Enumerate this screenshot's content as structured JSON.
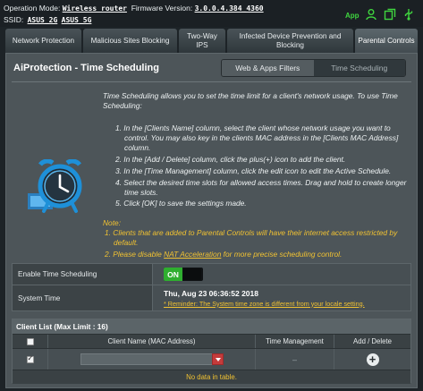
{
  "header": {
    "operation_mode_label": "Operation Mode:",
    "operation_mode_value": "Wireless router",
    "firmware_label": "Firmware Version:",
    "firmware_value": "3.0.0.4.384_4360",
    "ssid_label": "SSID:",
    "ssid_values": [
      "ASUS_2G",
      "ASUS_5G"
    ],
    "app_label": "App",
    "icons": [
      "users-icon",
      "copy-icon",
      "usb-icon"
    ]
  },
  "tabs": [
    {
      "label": "Network Protection",
      "active": false
    },
    {
      "label": "Malicious Sites Blocking",
      "active": false
    },
    {
      "label": "Two-Way IPS",
      "active": false
    },
    {
      "label": "Infected Device Prevention and Blocking",
      "active": false
    },
    {
      "label": "Parental Controls",
      "active": true
    }
  ],
  "page": {
    "title": "AiProtection - Time Scheduling",
    "segments": [
      "Web & Apps Filters",
      "Time Scheduling"
    ],
    "active_segment": 1,
    "intro": "Time Scheduling allows you to set the time limit for a client's network usage. To use Time Scheduling:",
    "steps": [
      "1. In the [Clients Name] column, select the client whose network usage you want to control. You may also key in the clients MAC address in the [Clients MAC Address] column.",
      "2. In the [Add / Delete] column, click the plus(+) icon to add the client.",
      "3. In the [Time Management] column, click the edit icon to edit the Active Schedule.",
      "4. Select the desired time slots for allowed access times. Drag and hold to create longer time slots.",
      "5. Click [OK] to save the settings made."
    ],
    "note_title": "Note:",
    "note_1": "1. Clients that are added to Parental Controls will have their internet access restricted by default.",
    "note_2_prefix": "2. Please disable ",
    "note_2_link": "NAT Acceleration",
    "note_2_suffix": " for more precise scheduling control."
  },
  "settings": {
    "enable_label": "Enable Time Scheduling",
    "enable_value": "ON",
    "system_time_label": "System Time",
    "system_time_value": "Thu, Aug 23 06:36:52 2018",
    "system_time_reminder": "* Reminder: The System time zone is different from your locale setting."
  },
  "client_list": {
    "title": "Client List (Max Limit : 16)",
    "columns": [
      "",
      "Client Name (MAC Address)",
      "Time Management",
      "Add / Delete"
    ],
    "input_placeholder": "",
    "time_mgmt_placeholder": "–",
    "empty_text": "No data in table."
  },
  "colors": {
    "accent_green": "#2fae2f",
    "warning_yellow": "#f1c232",
    "clock_blue": "#1e90d8"
  }
}
